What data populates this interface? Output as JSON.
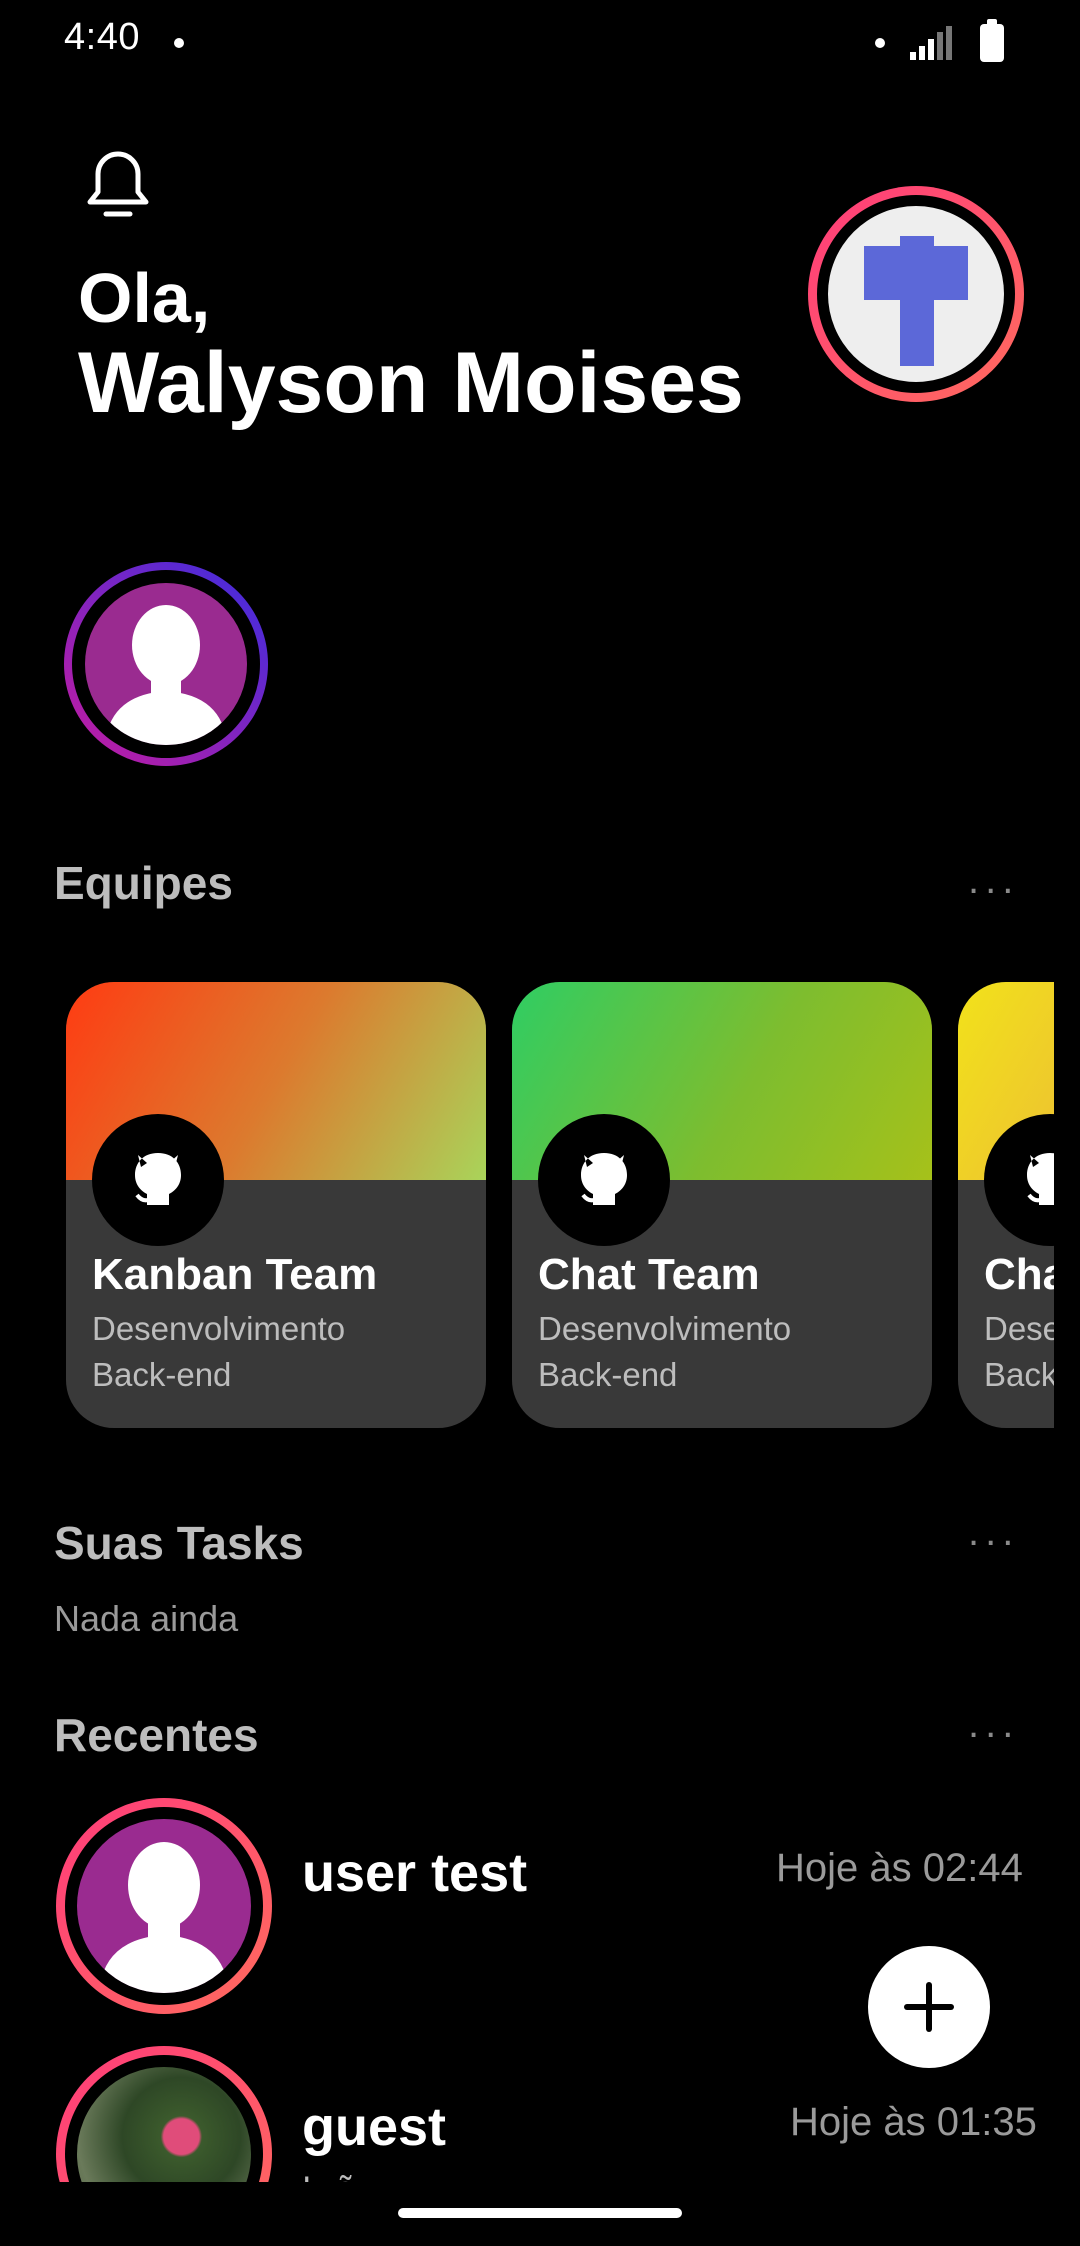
{
  "status_bar": {
    "time": "4:40"
  },
  "header": {
    "greeting": "Ola,",
    "user_name": "Walyson Moises"
  },
  "sections": {
    "teams_title": "Equipes",
    "tasks_title": "Suas Tasks",
    "tasks_empty": "Nada ainda",
    "recent_title": "Recentes",
    "more_label": "..."
  },
  "teams": [
    {
      "name": "Kanban Team",
      "line1": "Desenvolvimento",
      "line2": "Back-end",
      "icon": "github-icon",
      "gradient_start": "#ff3b12",
      "gradient_end": "#a9d45a"
    },
    {
      "name": "Chat Team",
      "line1": "Desenvolvimento",
      "line2": "Back-end",
      "icon": "github-icon",
      "gradient_start": "#2fcd63",
      "gradient_end": "#a6c11a"
    },
    {
      "name": "Chat Team",
      "line1": "Desenvolvimento",
      "line2": "Back-end",
      "icon": "github-icon",
      "gradient_start": "#f2e21a",
      "gradient_end": "#e58f56"
    }
  ],
  "recents": [
    {
      "name": "user test",
      "time": "Hoje às 02:44",
      "preview": ""
    },
    {
      "name": "guest",
      "time": "Hoje às 01:35",
      "preview": "Iwã"
    }
  ],
  "colors": {
    "accent_ring": "#ff3c7a",
    "story_ring_start": "#c61ba0",
    "story_ring_end": "#3b2de0",
    "card_bg": "#393939"
  }
}
